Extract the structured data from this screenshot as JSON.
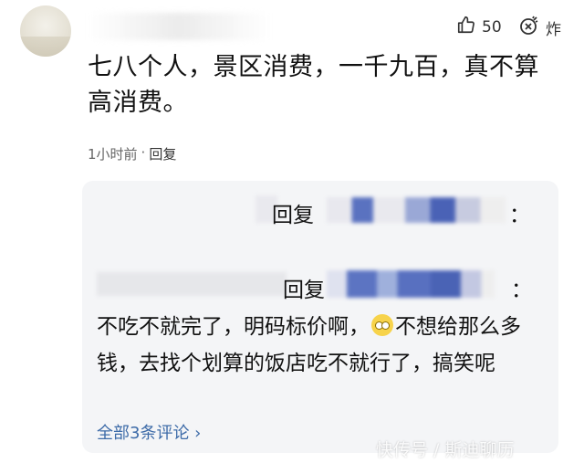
{
  "comment": {
    "likes": "50",
    "bomb_label": "炸",
    "text": "七八个人，景区消费，一千九百，真不算高消费。",
    "time": "1小时前",
    "dot": "·",
    "reply_label": "回复"
  },
  "thread": {
    "reply1_suffix": "回复",
    "reply1_colon": "：",
    "reply2_suffix": "回复",
    "reply2_colon": "：",
    "reply2_text_a": "不吃不就完了，明码标价啊，",
    "reply2_text_b": "不想给那么多钱，去找个划算的饭店吃不就行了，搞笑呢",
    "more_label": "全部3条评论 ›",
    "emoji_name": "rolling-eyes-emoji"
  },
  "watermark": "快传号 / 斯迪聊历"
}
